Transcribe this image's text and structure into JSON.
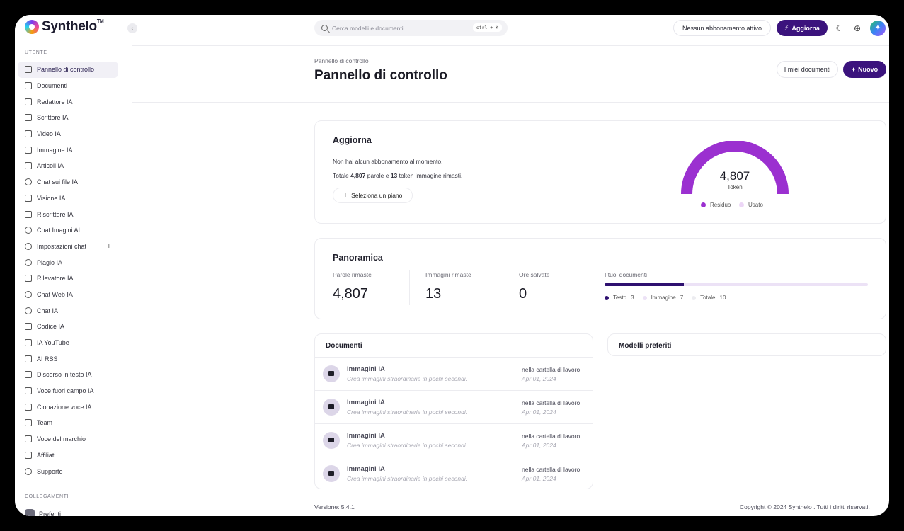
{
  "app": {
    "name": "Synthelo",
    "tm": "TM"
  },
  "sidebar": {
    "section_user": "UTENTE",
    "section_links": "COLLEGAMENTI",
    "items": [
      {
        "label": "Pannello di controllo",
        "icon": "grid-icon"
      },
      {
        "label": "Documenti",
        "icon": "archive-icon"
      },
      {
        "label": "Redattore IA",
        "icon": "document-icon"
      },
      {
        "label": "Scrittore IA",
        "icon": "document-text-icon"
      },
      {
        "label": "Video IA",
        "icon": "video-icon"
      },
      {
        "label": "Immagine IA",
        "icon": "image-icon"
      },
      {
        "label": "Articoli IA",
        "icon": "article-icon"
      },
      {
        "label": "Chat sui file IA",
        "icon": "file-chat-icon"
      },
      {
        "label": "Visione IA",
        "icon": "scan-icon"
      },
      {
        "label": "Riscrittore IA",
        "icon": "pen-icon"
      },
      {
        "label": "Chat Imagini AI",
        "icon": "image-chat-icon"
      },
      {
        "label": "Impostazioni chat",
        "icon": "chat-bubble-icon"
      },
      {
        "label": "Plagio IA",
        "icon": "spinner-icon"
      },
      {
        "label": "Rilevatore IA",
        "icon": "detector-icon"
      },
      {
        "label": "Chat Web IA",
        "icon": "globe-icon"
      },
      {
        "label": "Chat IA",
        "icon": "chat-icon"
      },
      {
        "label": "Codice IA",
        "icon": "terminal-icon"
      },
      {
        "label": "IA YouTube",
        "icon": "youtube-icon"
      },
      {
        "label": "AI RSS",
        "icon": "rss-icon"
      },
      {
        "label": "Discorso in testo IA",
        "icon": "microphone-icon"
      },
      {
        "label": "Voce fuori campo IA",
        "icon": "speaker-icon"
      },
      {
        "label": "Clonazione voce IA",
        "icon": "wrench-icon"
      },
      {
        "label": "Team",
        "icon": "user-icon"
      },
      {
        "label": "Voce del marchio",
        "icon": "brand-icon"
      },
      {
        "label": "Affiliati",
        "icon": "dollar-icon"
      },
      {
        "label": "Supporto",
        "icon": "support-icon"
      }
    ],
    "links": [
      {
        "label": "Preferiti"
      }
    ]
  },
  "topbar": {
    "search_placeholder": "Cerca modelli e documenti...",
    "shortcut": "ctrl + K",
    "subscription_status": "Nessun abbonamento attivo",
    "upgrade_label": "Aggiorna"
  },
  "header": {
    "breadcrumb": "Pannello di controllo",
    "title": "Pannello di controllo",
    "my_documents_label": "I miei documenti",
    "new_label": "Nuovo"
  },
  "upgrade_card": {
    "title": "Aggiorna",
    "no_subscription": "Non hai alcun abbonamento al momento.",
    "remaining_prefix": "Totale",
    "words": "4,807",
    "words_mid": "parole e",
    "image_tokens": "13",
    "remaining_suffix": "token immagine rimasti.",
    "select_plan_label": "Seleziona un piano",
    "gauge_value": "4,807",
    "gauge_unit": "Token",
    "gauge_fraction_remaining": 1.0,
    "legend_remaining": "Residuo",
    "legend_used": "Usato",
    "color_remaining": "#9b30d0",
    "color_used": "#ecd6f6"
  },
  "overview": {
    "title": "Panoramica",
    "words_label": "Parole rimaste",
    "words_value": "4,807",
    "images_label": "Immagini rimaste",
    "images_value": "13",
    "hours_label": "Ore salvate",
    "hours_value": "0",
    "docs_label": "I tuoi documenti",
    "docs_text_fraction": 0.3,
    "legend": [
      {
        "label": "Testo",
        "count": "3",
        "color": "#2e1070"
      },
      {
        "label": "Immagine",
        "count": "7",
        "color": "#ece2f6"
      },
      {
        "label": "Totale",
        "count": "10",
        "color": "#ececf0"
      }
    ]
  },
  "documents": {
    "title": "Documenti",
    "rows": [
      {
        "name": "Immagini IA",
        "desc": "Crea immagini straordinarie in pochi secondi.",
        "location": "nella cartella di lavoro",
        "date": "Apr 01, 2024"
      },
      {
        "name": "Immagini IA",
        "desc": "Crea immagini straordinarie in pochi secondi.",
        "location": "nella cartella di lavoro",
        "date": "Apr 01, 2024"
      },
      {
        "name": "Immagini IA",
        "desc": "Crea immagini straordinarie in pochi secondi.",
        "location": "nella cartella di lavoro",
        "date": "Apr 01, 2024"
      },
      {
        "name": "Immagini IA",
        "desc": "Crea immagini straordinarie in pochi secondi.",
        "location": "nella cartella di lavoro",
        "date": "Apr 01, 2024"
      }
    ]
  },
  "favorites": {
    "title": "Modelli preferiti"
  },
  "footer": {
    "version": "Versione: 5.4.1",
    "copyright": "Copyright © 2024 Synthelo . Tutti i diritti riservati."
  }
}
